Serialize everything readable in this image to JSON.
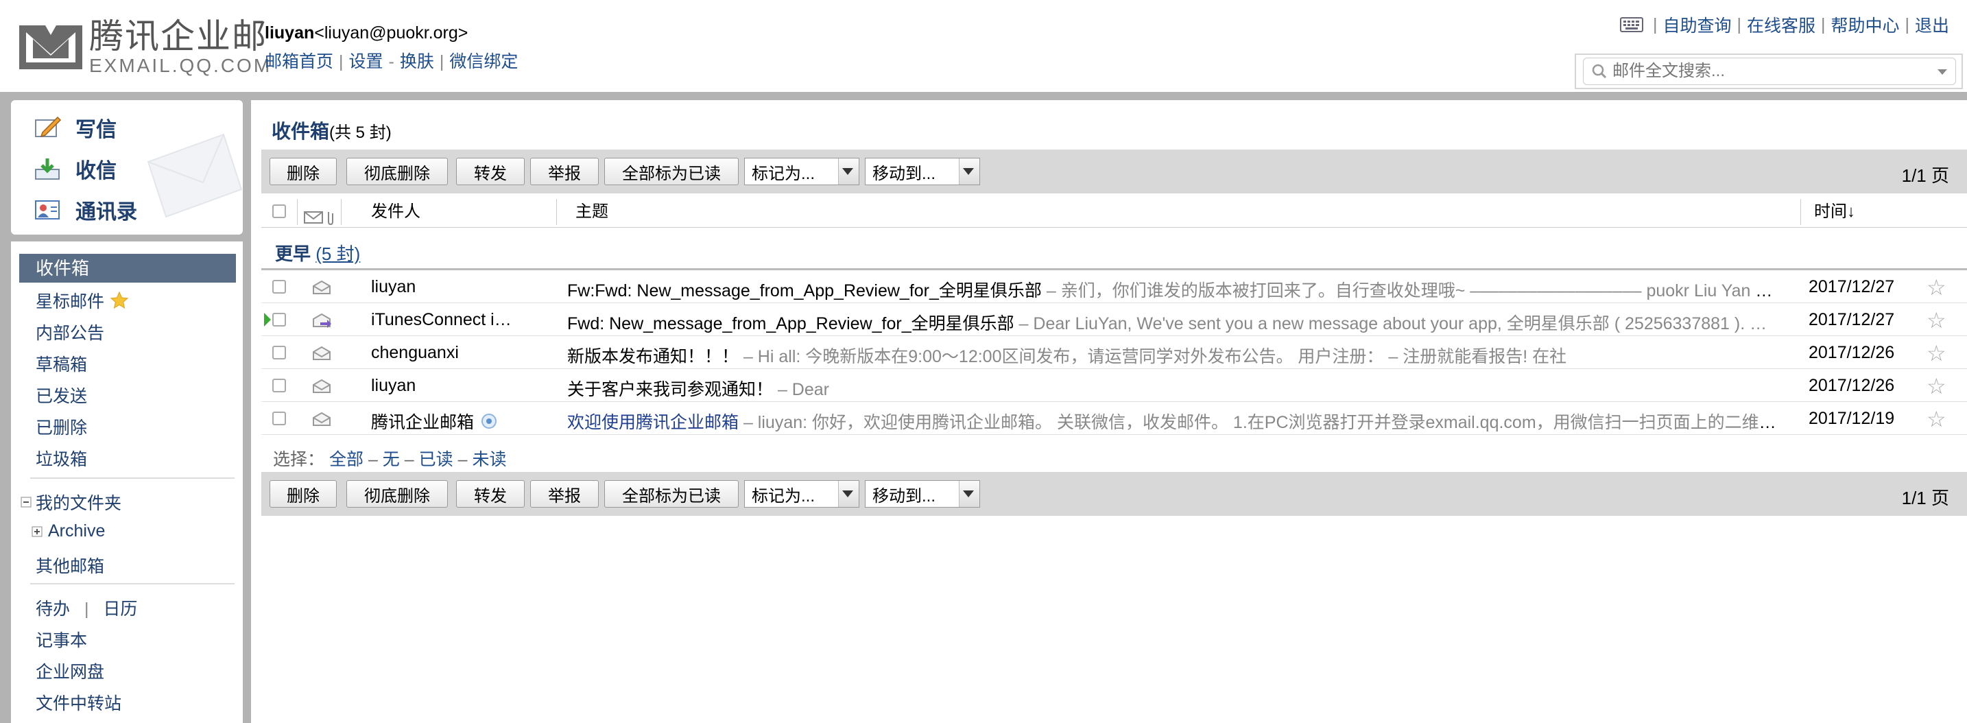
{
  "header": {
    "logo_cn": "腾讯企业邮",
    "logo_en": "EXMAIL.QQ.COM",
    "user_name": "liuyan",
    "user_email": "<liuyan@puokr.org>",
    "nav": [
      "邮箱首页",
      "设置",
      "换肤",
      "微信绑定"
    ],
    "top_links": [
      "自助查询",
      "在线客服",
      "帮助中心",
      "退出"
    ],
    "search_placeholder": "邮件全文搜索..."
  },
  "quick_actions": {
    "compose": "写信",
    "receive": "收信",
    "contacts": "通讯录"
  },
  "sidebar": {
    "inbox": "收件箱",
    "starred": "星标邮件",
    "internal": "内部公告",
    "drafts": "草稿箱",
    "sent": "已发送",
    "deleted": "已删除",
    "junk": "垃圾箱",
    "my_folders": "我的文件夹",
    "archive": "Archive",
    "other_mail": "其他邮箱",
    "todo": "待办",
    "calendar": "日历",
    "notes": "记事本",
    "netdisk": "企业网盘",
    "transfer": "文件中转站"
  },
  "main": {
    "title": "收件箱",
    "count": "(共 5 封)",
    "toolbar": {
      "delete": "删除",
      "delete_forever": "彻底删除",
      "forward": "转发",
      "report": "举报",
      "mark_all_read": "全部标为已读",
      "mark_as": "标记为...",
      "move_to": "移动到..."
    },
    "pager": "1/1 页",
    "columns": {
      "sender": "发件人",
      "subject": "主题",
      "time": "时间↓"
    },
    "group_label": "更早",
    "group_count": "(5 封)",
    "rows": [
      {
        "sender": "liuyan",
        "subject": "Fw:Fwd: New_message_from_App_Review_for_全明星俱乐部",
        "preview": " – 亲们，你们谁发的版本被打回来了。自行查收处理哦~ –––––––––––––––––– puokr Liu Yan 客…",
        "date": "2017/12/27"
      },
      {
        "sender": "iTunesConnect i…",
        "subject": "Fwd: New_message_from_App_Review_for_全明星俱乐部",
        "preview": " – Dear LiuYan, We've sent you a new message about your app, 全明星俱乐部 ( 25256337881 ). …",
        "date": "2017/12/27"
      },
      {
        "sender": "chenguanxi",
        "subject": "新版本发布通知！！！",
        "preview": " – Hi all: 今晚新版本在9:00～12:00区间发布，请运营同学对外发布公告。 用户注册： – 注册就能看报告! 在社",
        "date": "2017/12/26"
      },
      {
        "sender": "liuyan",
        "subject": "关于客户来我司参观通知！",
        "preview": " – Dear",
        "date": "2017/12/26"
      },
      {
        "sender": "腾讯企业邮箱",
        "subject": "欢迎使用腾讯企业邮箱",
        "preview": " – liuyan: 你好，欢迎使用腾讯企业邮箱。 关联微信，收发邮件。 1.在PC浏览器打开并登录exmail.qq.com，用微信扫一扫页面上的二维码。 …",
        "date": "2017/12/19"
      }
    ],
    "select": {
      "label": "选择：",
      "all": "全部",
      "none": "无",
      "read": "已读",
      "unread": "未读"
    }
  },
  "colors": {
    "link": "#1f4e8c",
    "active_folder": "#5a6d86",
    "frame": "#b3b3b3",
    "toolbar": "#d8d8d8"
  }
}
